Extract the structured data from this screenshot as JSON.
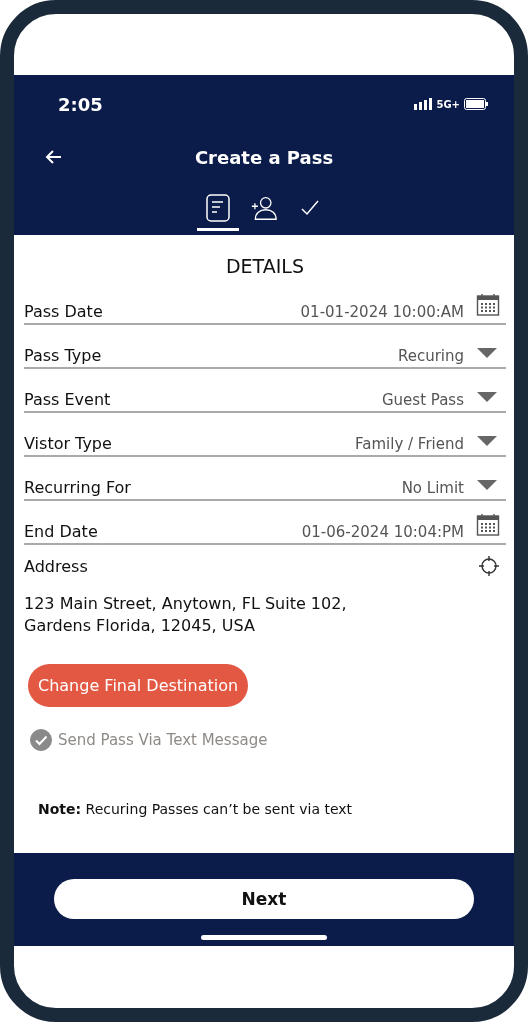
{
  "status_bar": {
    "time": "2:05",
    "network": "5G+"
  },
  "header": {
    "title": "Create a Pass"
  },
  "tabs": [
    {
      "kind": "details",
      "selected": true
    },
    {
      "kind": "add-person",
      "selected": false
    },
    {
      "kind": "confirm",
      "selected": false
    }
  ],
  "section_title": "DETAILS",
  "fields": [
    {
      "kind": "date",
      "label": "Pass Date",
      "value": "01-01-2024 10:00:AM"
    },
    {
      "kind": "select",
      "label": "Pass Type",
      "value": "Recuring"
    },
    {
      "kind": "select",
      "label": "Pass Event",
      "value": "Guest Pass"
    },
    {
      "kind": "select",
      "label": "Vistor Type",
      "value": "Family / Friend"
    },
    {
      "kind": "select",
      "label": "Recurring For",
      "value": "No Limit"
    },
    {
      "kind": "date",
      "label": "End Date",
      "value": "01-06-2024 10:04:PM"
    }
  ],
  "address": {
    "label": "Address",
    "value": "123 Main Street, Anytown, FL Suite 102,\nGardens Florida, 12045, USA"
  },
  "destination_button": "Change Final Destination",
  "text_option": {
    "label": "Send Pass Via Text Message",
    "checked": true,
    "disabled": true
  },
  "note": "**Note:** Recuring Passes can’t be sent via text",
  "next_button": "Next"
}
